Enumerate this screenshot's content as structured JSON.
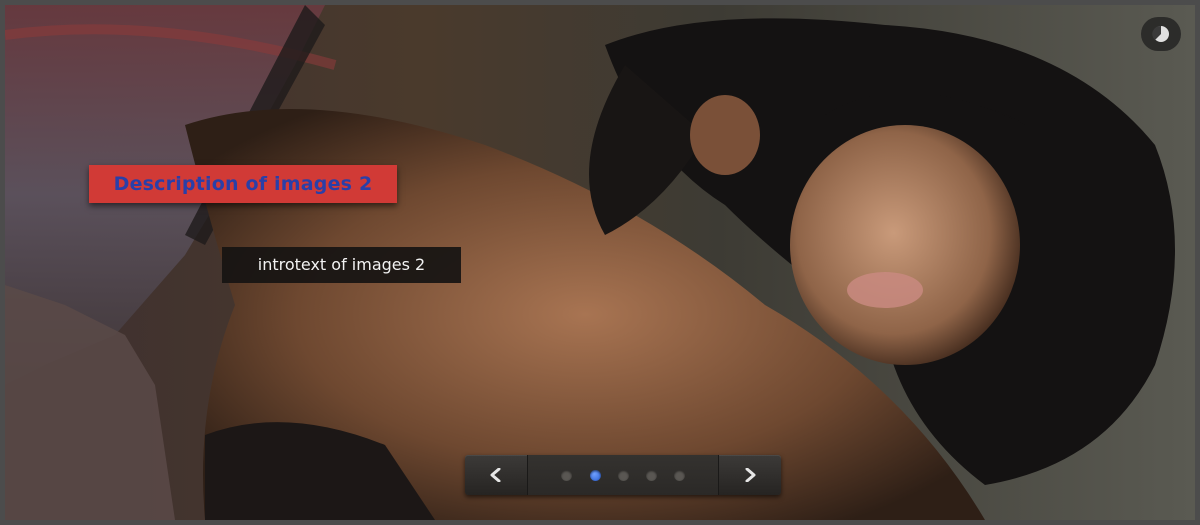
{
  "slider": {
    "current_index": 2,
    "caption": {
      "title": "Description of images 2",
      "intro": "introtext of images 2"
    },
    "navigation": {
      "prev_icon": "chevron-left-icon",
      "next_icon": "chevron-right-icon",
      "dot_count": 5,
      "active_dot": 2
    },
    "timer_icon": "pie-timer-icon"
  },
  "colors": {
    "title_bg": "#d13a36",
    "title_text": "#2a3fa8",
    "intro_bg": "#161412",
    "intro_text": "#f2f2f2",
    "active_dot": "#3b6fe6"
  }
}
